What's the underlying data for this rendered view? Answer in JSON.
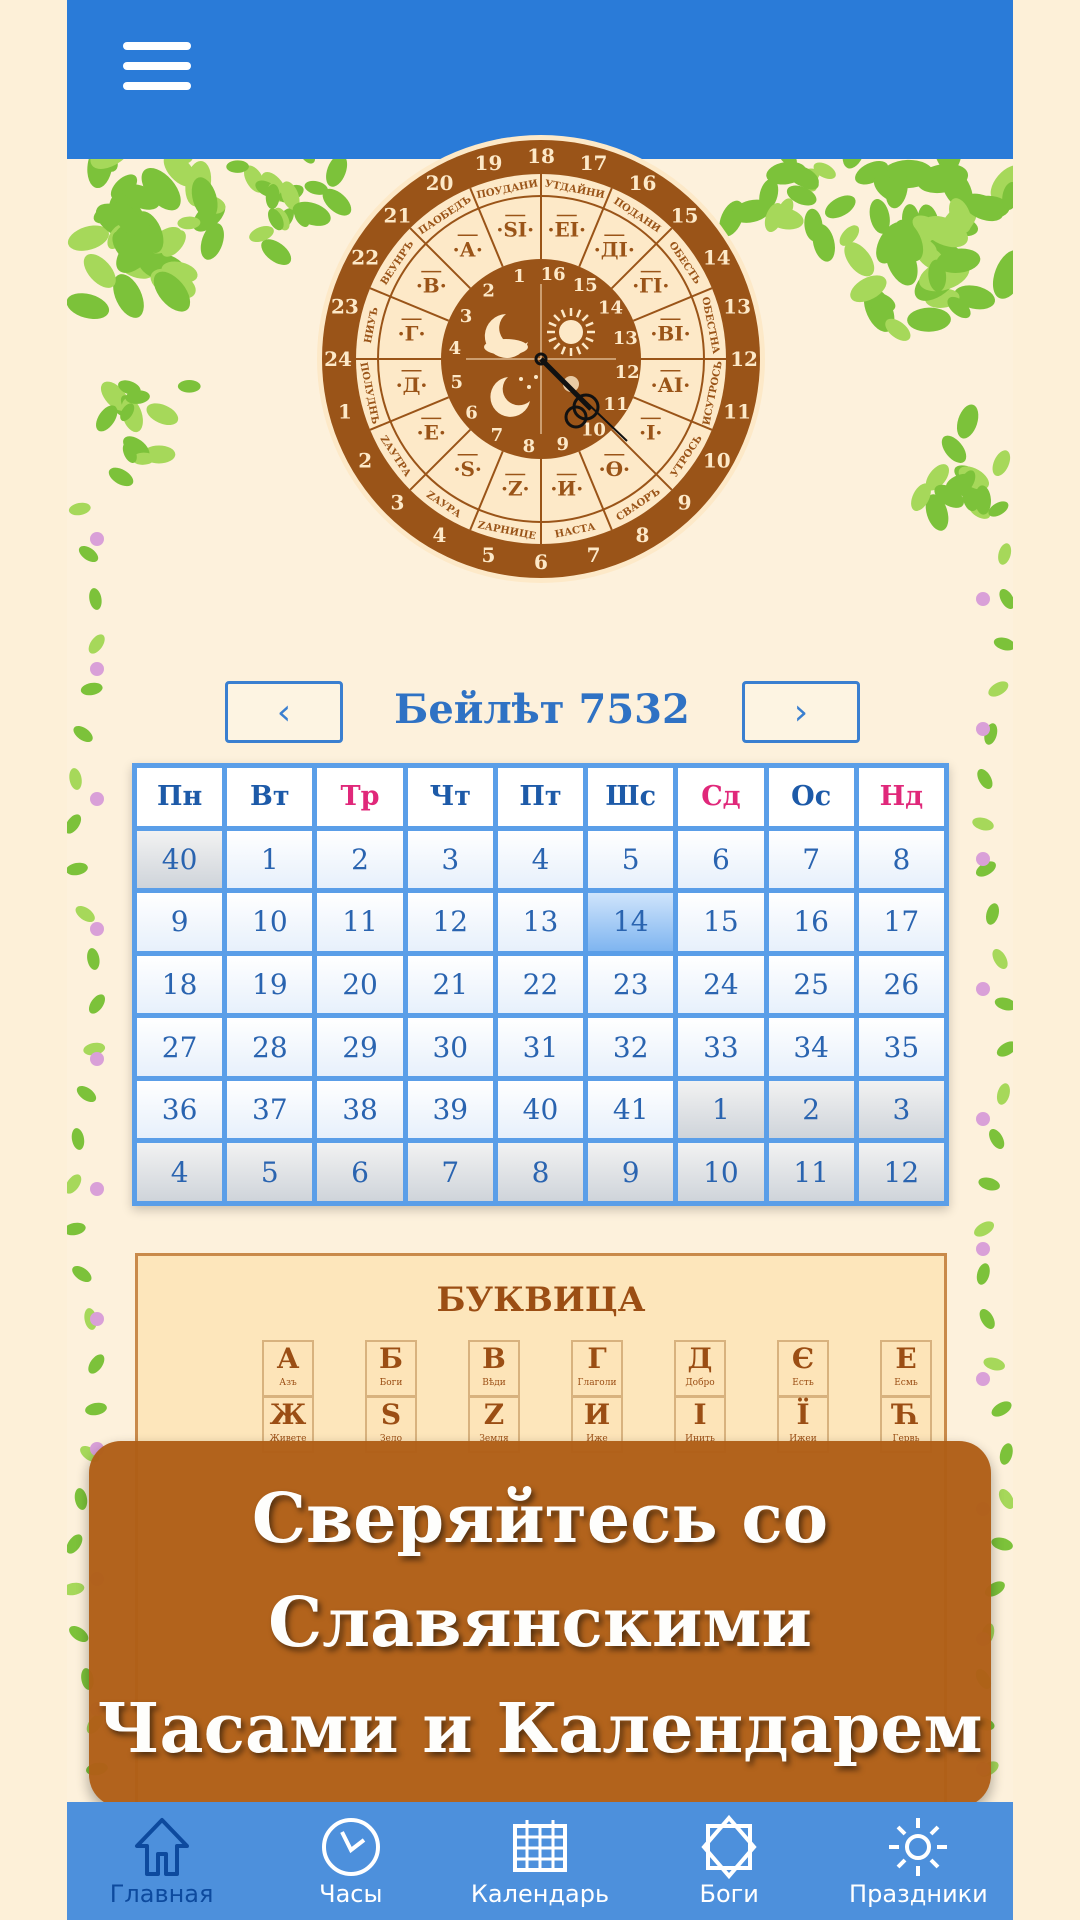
{
  "header": {
    "menu_icon": "hamburger-icon",
    "color": "#2a7bd8"
  },
  "clock": {
    "outer_hours": [
      1,
      2,
      3,
      4,
      5,
      6,
      7,
      8,
      9,
      10,
      11,
      12,
      13,
      14,
      15,
      16,
      17,
      18,
      19,
      20,
      21,
      22,
      23,
      24
    ],
    "segment_names": [
      "УТДАЙНИ",
      "ПОДАНИ",
      "ОБЕСТЬ",
      "ОБЕСТНА",
      "ИСУТРОСЬ",
      "УТРОСЬ",
      "СВАОРЪ",
      "НАСТА",
      "ZАРНИЦЕ",
      "ZАУРА",
      "ZАУТРА",
      "ПОЛУДНЪ",
      "НИУЪ",
      "ВЕУНРЪ",
      "ПАОБЕДЪ",
      "ПОУДАНИ"
    ],
    "segment_letters": [
      "ЕI",
      "ДI",
      "ГI",
      "ВI",
      "АI",
      "I",
      "Ѳ",
      "И",
      "Z",
      "Ѕ",
      "Е",
      "Д",
      "Г",
      "В",
      "А",
      "ЅI"
    ],
    "inner_hours": [
      1,
      2,
      3,
      4,
      5,
      6,
      7,
      8,
      9,
      10,
      11,
      12,
      13,
      14,
      15,
      16
    ],
    "colors": {
      "brown": "#9a5418",
      "cream": "#fde9c8"
    }
  },
  "calendar": {
    "prev_label": "‹",
    "next_label": "›",
    "title": "Бейлѣт 7532",
    "weekdays": [
      {
        "label": "Пн",
        "holiday": false
      },
      {
        "label": "Вт",
        "holiday": false
      },
      {
        "label": "Тр",
        "holiday": true
      },
      {
        "label": "Чт",
        "holiday": false
      },
      {
        "label": "Пт",
        "holiday": false
      },
      {
        "label": "Шс",
        "holiday": false
      },
      {
        "label": "Сд",
        "holiday": true
      },
      {
        "label": "Ос",
        "holiday": false
      },
      {
        "label": "Нд",
        "holiday": true
      }
    ],
    "days": [
      {
        "d": "40",
        "other": true
      },
      {
        "d": "1"
      },
      {
        "d": "2"
      },
      {
        "d": "3"
      },
      {
        "d": "4"
      },
      {
        "d": "5"
      },
      {
        "d": "6"
      },
      {
        "d": "7"
      },
      {
        "d": "8"
      },
      {
        "d": "9"
      },
      {
        "d": "10"
      },
      {
        "d": "11"
      },
      {
        "d": "12"
      },
      {
        "d": "13"
      },
      {
        "d": "14",
        "today": true
      },
      {
        "d": "15"
      },
      {
        "d": "16"
      },
      {
        "d": "17"
      },
      {
        "d": "18"
      },
      {
        "d": "19"
      },
      {
        "d": "20"
      },
      {
        "d": "21"
      },
      {
        "d": "22"
      },
      {
        "d": "23"
      },
      {
        "d": "24"
      },
      {
        "d": "25"
      },
      {
        "d": "26"
      },
      {
        "d": "27"
      },
      {
        "d": "28"
      },
      {
        "d": "29"
      },
      {
        "d": "30"
      },
      {
        "d": "31"
      },
      {
        "d": "32"
      },
      {
        "d": "33"
      },
      {
        "d": "34"
      },
      {
        "d": "35"
      },
      {
        "d": "36"
      },
      {
        "d": "37"
      },
      {
        "d": "38"
      },
      {
        "d": "39"
      },
      {
        "d": "40"
      },
      {
        "d": "41"
      },
      {
        "d": "1",
        "other": true
      },
      {
        "d": "2",
        "other": true
      },
      {
        "d": "3",
        "other": true
      },
      {
        "d": "4",
        "other": true
      },
      {
        "d": "5",
        "other": true
      },
      {
        "d": "6",
        "other": true
      },
      {
        "d": "7",
        "other": true
      },
      {
        "d": "8",
        "other": true
      },
      {
        "d": "9",
        "other": true
      },
      {
        "d": "10",
        "other": true
      },
      {
        "d": "11",
        "other": true
      },
      {
        "d": "12",
        "other": true
      }
    ]
  },
  "bukvica": {
    "title": "БУКВИЦА",
    "letters": [
      {
        "l": "А",
        "n": "Азъ"
      },
      {
        "l": "Б",
        "n": "Боги"
      },
      {
        "l": "В",
        "n": "Вѣди"
      },
      {
        "l": "Г",
        "n": "Глаголи"
      },
      {
        "l": "Д",
        "n": "Добро"
      },
      {
        "l": "Є",
        "n": "Есть"
      },
      {
        "l": "Е",
        "n": "Есмь"
      },
      {
        "l": "Ж",
        "n": "Живете"
      },
      {
        "l": "Ѕ",
        "n": "Зело"
      },
      {
        "l": "Z",
        "n": "Земля"
      },
      {
        "l": "И",
        "n": "Иже"
      },
      {
        "l": "І",
        "n": "Инить"
      },
      {
        "l": "Ї",
        "n": "Ижеи"
      },
      {
        "l": "Ћ",
        "n": "Гервь"
      }
    ]
  },
  "banner": {
    "lines": [
      "Сверяйтесь со",
      "Славянскими",
      "Часами и Календарем"
    ],
    "color": "#b05f17"
  },
  "bottom_nav": {
    "items": [
      {
        "label": "Главная",
        "icon": "home-icon",
        "active": true
      },
      {
        "label": "Часы",
        "icon": "clock-icon",
        "active": false
      },
      {
        "label": "Календарь",
        "icon": "calendar-icon",
        "active": false
      },
      {
        "label": "Боги",
        "icon": "star-of-svarog-icon",
        "active": false
      },
      {
        "label": "Праздники",
        "icon": "sun-icon",
        "active": false
      }
    ]
  }
}
